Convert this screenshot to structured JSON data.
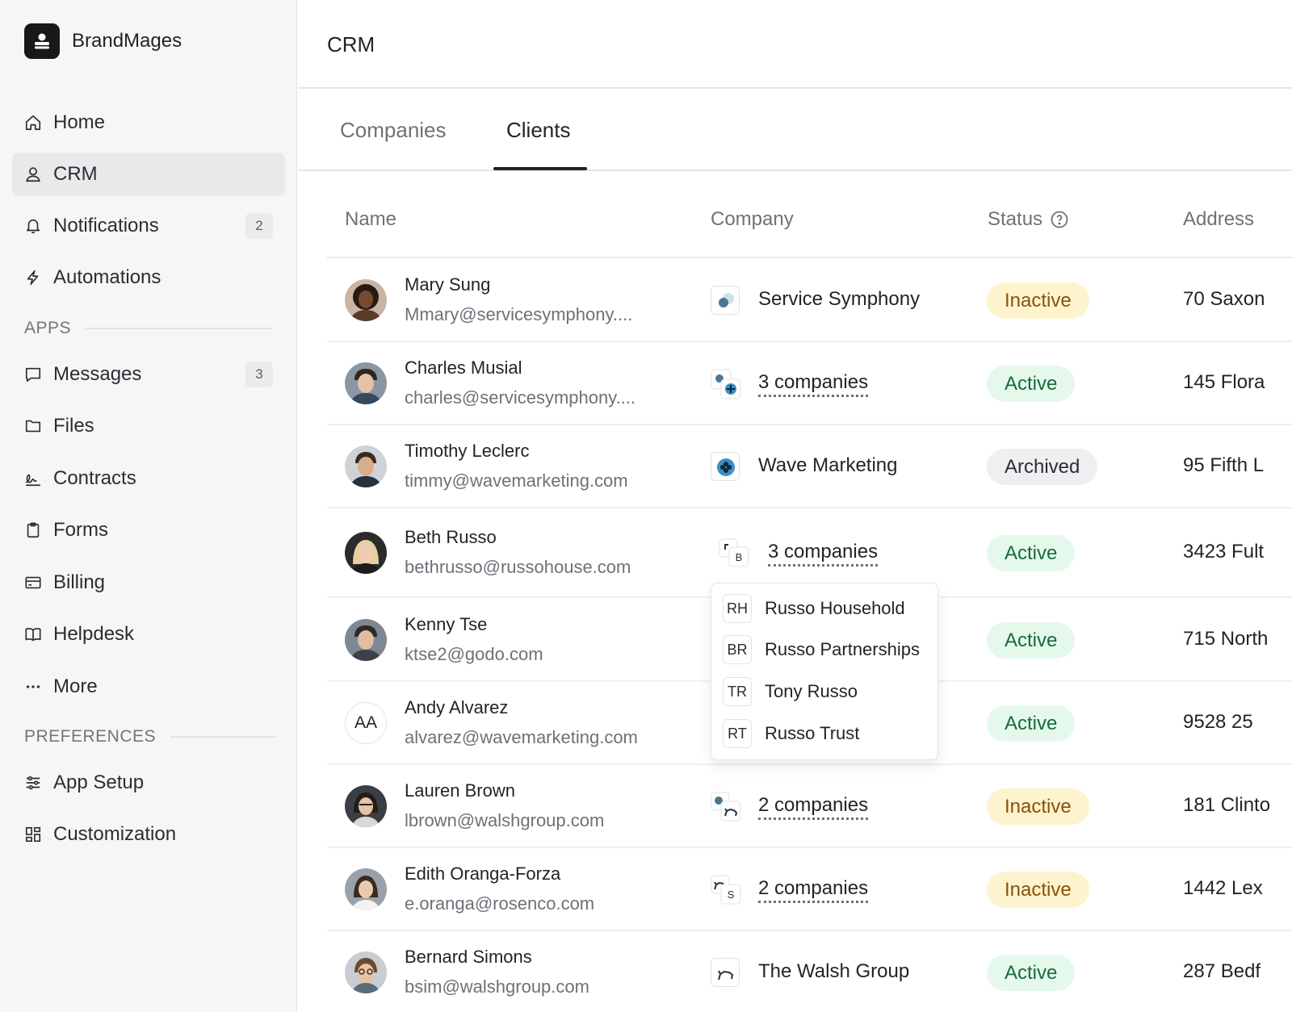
{
  "brand": {
    "name": "BrandMages",
    "icon": "user-stack-icon"
  },
  "sidebar": {
    "items": [
      {
        "label": "Home",
        "icon": "home-icon"
      },
      {
        "label": "CRM",
        "icon": "user-icon",
        "active": true
      },
      {
        "label": "Notifications",
        "icon": "bell-icon",
        "count": "2"
      },
      {
        "label": "Automations",
        "icon": "bolt-icon"
      }
    ],
    "apps_label": "APPS",
    "apps": [
      {
        "label": "Messages",
        "icon": "message-icon",
        "count": "3"
      },
      {
        "label": "Files",
        "icon": "folder-icon"
      },
      {
        "label": "Contracts",
        "icon": "signature-icon"
      },
      {
        "label": "Forms",
        "icon": "clipboard-icon"
      },
      {
        "label": "Billing",
        "icon": "credit-card-icon"
      },
      {
        "label": "Helpdesk",
        "icon": "book-icon"
      },
      {
        "label": "More",
        "icon": "ellipsis-icon"
      }
    ],
    "preferences_label": "PREFERENCES",
    "preferences": [
      {
        "label": "App Setup",
        "icon": "sliders-icon"
      },
      {
        "label": "Customization",
        "icon": "grid-icon"
      }
    ]
  },
  "header": {
    "title": "CRM"
  },
  "tabs": [
    {
      "label": "Companies"
    },
    {
      "label": "Clients",
      "active": true
    }
  ],
  "table": {
    "columns": {
      "name": "Name",
      "company": "Company",
      "status": "Status",
      "address": "Address"
    },
    "rows": [
      {
        "name": "Mary Sung",
        "email": "Mmary@servicesymphony....",
        "company": "Service Symphony",
        "status": "Inactive",
        "address": "70 Saxon"
      },
      {
        "name": "Charles Musial",
        "email": "charles@servicesymphony....",
        "company": "3 companies",
        "status": "Active",
        "address": "145 Flora"
      },
      {
        "name": "Timothy Leclerc",
        "email": "timmy@wavemarketing.com",
        "company": "Wave Marketing",
        "status": "Archived",
        "address": "95 Fifth L"
      },
      {
        "name": "Beth Russo",
        "email": "bethrusso@russohouse.com",
        "company": "3 companies",
        "status": "Active",
        "address": "3423 Fult"
      },
      {
        "name": "Kenny Tse",
        "email": "ktse2@godo.com",
        "company": "",
        "status": "Active",
        "address": "715 North"
      },
      {
        "name": "Andy Alvarez",
        "email": "alvarez@wavemarketing.com",
        "initials": "AA",
        "company": "",
        "status": "Active",
        "address": "9528 25"
      },
      {
        "name": "Lauren Brown",
        "email": "lbrown@walshgroup.com",
        "company": "2 companies",
        "status": "Inactive",
        "address": "181 Clinto"
      },
      {
        "name": "Edith Oranga-Forza",
        "email": "e.oranga@rosenco.com",
        "company": "2 companies",
        "status": "Inactive",
        "address": "1442 Lex"
      },
      {
        "name": "Bernard Simons",
        "email": "bsim@walshgroup.com",
        "company": "The Walsh Group",
        "status": "Active",
        "address": "287 Bedf"
      }
    ]
  },
  "popover": {
    "items": [
      {
        "initials": "RH",
        "name": "Russo Household"
      },
      {
        "initials": "BR",
        "name": "Russo Partnerships"
      },
      {
        "initials": "TR",
        "name": "Tony Russo"
      },
      {
        "initials": "RT",
        "name": "Russo Trust"
      }
    ]
  },
  "colors": {
    "inactive_bg": "#fdf3cf",
    "inactive_text": "#8a5209",
    "active_bg": "#e5f8ec",
    "active_text": "#176b3a",
    "archived_bg": "#eeeff1"
  }
}
